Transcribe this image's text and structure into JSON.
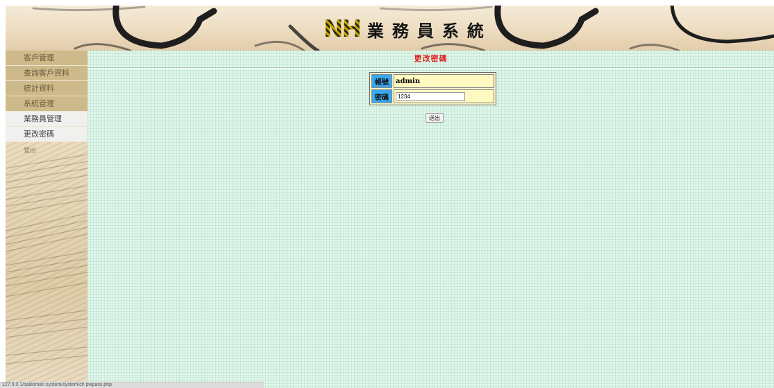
{
  "header": {
    "logo_mark": "NH",
    "logo_title": "業務員系統"
  },
  "sidebar": {
    "items": [
      {
        "label": "客戶管理",
        "style": "tan"
      },
      {
        "label": "查詢客戶資料",
        "style": "tan"
      },
      {
        "label": "統計資料",
        "style": "tan"
      },
      {
        "label": "系統管理",
        "style": "tan"
      },
      {
        "label": "業務員管理",
        "style": "light"
      },
      {
        "label": "更改密碼",
        "style": "light"
      }
    ],
    "logout_label": "登出"
  },
  "main": {
    "title": "更改密碼",
    "form": {
      "account_label": "帳號",
      "account_value": "admin",
      "password_label": "密碼",
      "password_value": "1234"
    },
    "submit_label": "送出"
  },
  "status_bar": {
    "url": "127.0.0.1/salesman system/system/ch pwpass.php"
  },
  "colors": {
    "main_bg": "#dff7ea",
    "title_red": "#e02020",
    "label_blue": "#3aa8f0",
    "value_yellow": "#fff9c0",
    "menu_tan": "#cdb98a"
  }
}
